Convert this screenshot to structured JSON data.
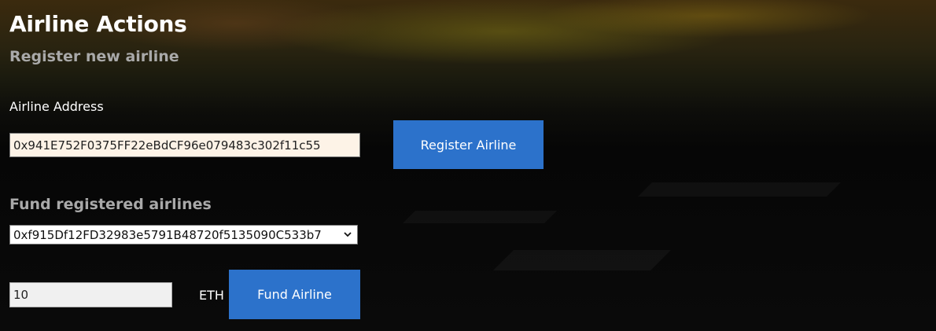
{
  "page": {
    "title": "Airline Actions",
    "subtitle": "Register new airline"
  },
  "register": {
    "address_label": "Airline Address",
    "address_value": "0x941E752F0375FF22eBdCF96e079483c302f11c55",
    "button_label": "Register Airline"
  },
  "fund": {
    "section_title": "Fund registered airlines",
    "selected_airline": "0xf915Df12FD32983e5791B48720f5135090C533b7",
    "amount_value": "10",
    "unit_label": "ETH",
    "button_label": "Fund Airline"
  },
  "colors": {
    "button_bg": "#2c72cb",
    "subtitle_text": "#a9a9a9",
    "address_field_bg": "#fdf3e7"
  },
  "icons": {
    "dropdown": "chevron-down-icon"
  }
}
